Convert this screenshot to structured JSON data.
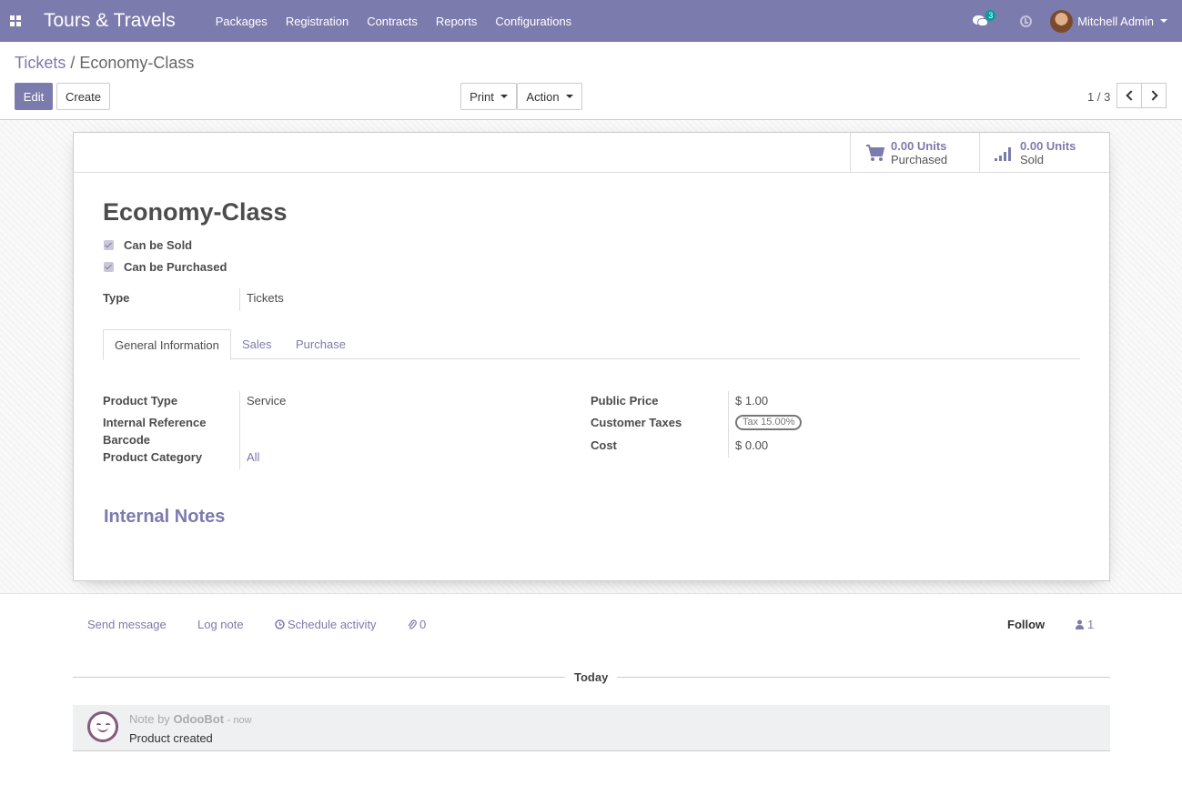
{
  "navbar": {
    "app_title": "Tours & Travels",
    "menu": [
      "Packages",
      "Registration",
      "Contracts",
      "Reports",
      "Configurations"
    ],
    "messages_badge": "3",
    "user_name": "Mitchell Admin",
    "accent": "#7c7bad",
    "icons": [
      "apps-icon",
      "chat-icon",
      "clock-icon",
      "avatar",
      "caret-down-icon"
    ]
  },
  "breadcrumb": {
    "parent": "Tickets",
    "separator": "/",
    "current": "Economy-Class"
  },
  "toolbar": {
    "edit": "Edit",
    "create": "Create",
    "print": "Print",
    "action": "Action"
  },
  "pager": {
    "value": "1 / 3"
  },
  "stats": {
    "purchased": {
      "value": "0.00 Units",
      "label": "Purchased",
      "icon": "cart-icon"
    },
    "sold": {
      "value": "0.00 Units",
      "label": "Sold",
      "icon": "signal-bars-icon"
    }
  },
  "product": {
    "name": "Economy-Class",
    "can_be_sold": {
      "label": "Can be Sold",
      "checked": true
    },
    "can_be_purchased": {
      "label": "Can be Purchased",
      "checked": true
    },
    "type_label": "Type",
    "type_value": "Tickets"
  },
  "tabs": [
    "General Information",
    "Sales",
    "Purchase"
  ],
  "general": {
    "left": [
      {
        "label": "Product Type",
        "value": "Service"
      },
      {
        "label": "Internal Reference",
        "value": ""
      },
      {
        "label": "Barcode",
        "value": ""
      },
      {
        "label": "Product Category",
        "value": "All"
      }
    ],
    "right": [
      {
        "label": "Public Price",
        "value": "$ 1.00"
      },
      {
        "label": "Customer Taxes",
        "value": "Tax 15.00%"
      },
      {
        "label": "Cost",
        "value": "$ 0.00"
      }
    ]
  },
  "notes_title": "Internal Notes",
  "chatter": {
    "send_message": "Send message",
    "log_note": "Log note",
    "schedule_activity": "Schedule activity",
    "attachments": "0",
    "follow": "Follow",
    "followers": "1",
    "date_separator": "Today",
    "message": {
      "prefix": "Note by",
      "author": "OdooBot",
      "time": "- now",
      "body": "Product created"
    }
  }
}
